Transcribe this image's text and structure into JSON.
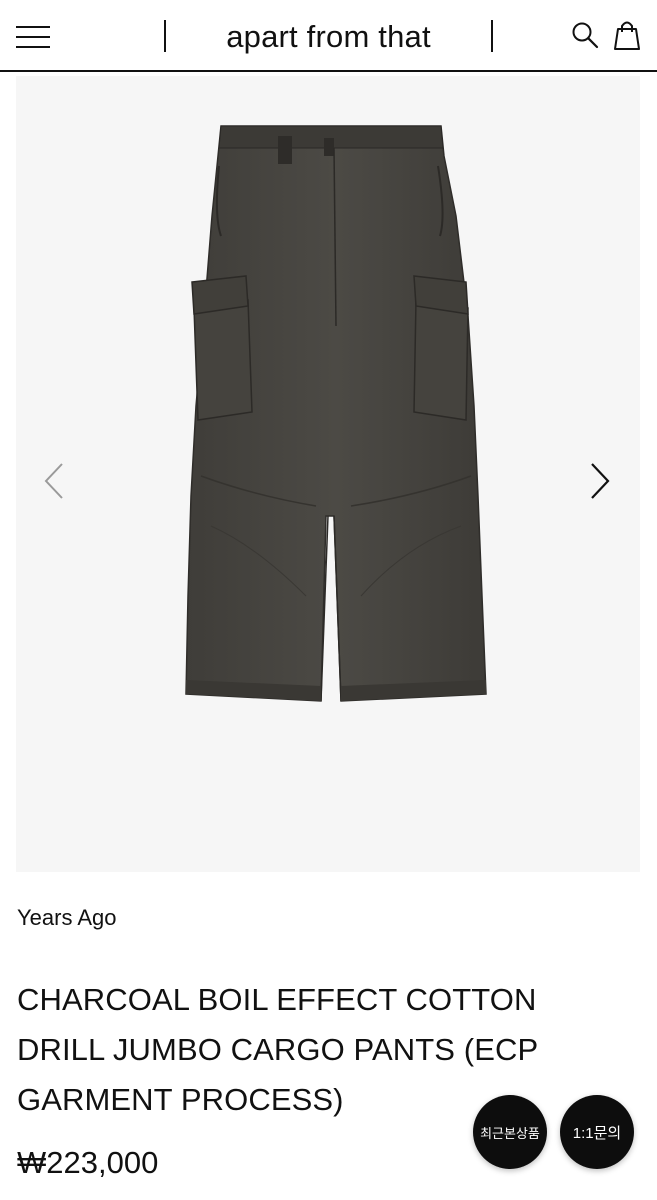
{
  "header": {
    "brand": "apart from that",
    "menu_icon": "hamburger-menu-icon",
    "search_icon": "search-icon",
    "cart_icon": "shopping-bag-icon"
  },
  "gallery": {
    "prev_icon": "chevron-left-icon",
    "next_icon": "chevron-right-icon",
    "image": "charcoal cargo pants product photo"
  },
  "product": {
    "brand_name": "Years Ago",
    "title": "CHARCOAL BOIL EFFECT COTTON DRILL JUMBO CARGO PANTS (ECP GARMENT PROCESS)",
    "price": "₩223,000"
  },
  "floating": {
    "recent_label": "최근본상품",
    "inquiry_label": "1:1문의"
  },
  "colors": {
    "text": "#111111",
    "fab_background": "#0d0d0d",
    "image_background": "#f6f6f6",
    "pants": "#46443f"
  }
}
